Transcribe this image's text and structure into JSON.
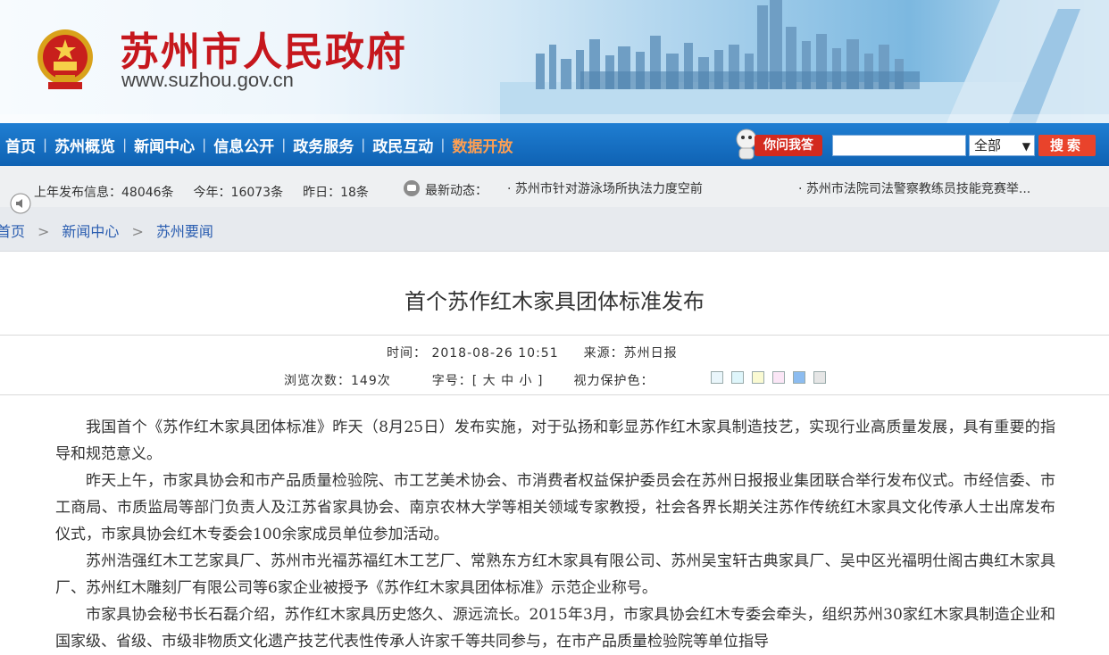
{
  "header": {
    "site_title": "苏州市人民政府",
    "site_url": "www.suzhou.gov.cn"
  },
  "nav": {
    "items": [
      "首页",
      "苏州概览",
      "新闻中心",
      "信息公开",
      "政务服务",
      "政民互动",
      "数据开放"
    ],
    "separator": "|",
    "ask_label": "你问我答",
    "search_placeholder": "",
    "search_scope": "全部",
    "search_button": "搜索"
  },
  "infobar": {
    "last_year": "上年发布信息：48046条",
    "this_year": "今年：16073条",
    "yesterday": "昨日：18条",
    "latest_label": "最新动态：",
    "news": [
      "· 苏州市针对游泳场所执法力度空前",
      "· 苏州市法院司法警察教练员技能竞赛举..."
    ]
  },
  "breadcrumb": [
    "首页",
    "新闻中心",
    "苏州要闻"
  ],
  "article": {
    "title": "首个苏作红木家具团体标准发布",
    "time": "时间： 2018-08-26 10:51",
    "source": "来源：苏州日报",
    "views": "浏览次数：149次",
    "font_size": "字号：[ 大  中  小 ]",
    "eye_care": "视力保护色：",
    "eye_colors": [
      "#eaf6fb",
      "#dff6fb",
      "#fafad2",
      "#fbe6f6",
      "#8cbcf0",
      "#e6e6e6"
    ],
    "paragraphs": [
      "我国首个《苏作红木家具团体标准》昨天（8月25日）发布实施，对于弘扬和彰显苏作红木家具制造技艺，实现行业高质量发展，具有重要的指导和规范意义。",
      "昨天上午，市家具协会和市产品质量检验院、市工艺美术协会、市消费者权益保护委员会在苏州日报报业集团联合举行发布仪式。市经信委、市工商局、市质监局等部门负责人及江苏省家具协会、南京农林大学等相关领域专家教授，社会各界长期关注苏作传统红木家具文化传承人士出席发布仪式，市家具协会红木专委会100余家成员单位参加活动。",
      "苏州浩强红木工艺家具厂、苏州市光福苏福红木工艺厂、常熟东方红木家具有限公司、苏州吴宝轩古典家具厂、吴中区光福明仕阁古典红木家具厂、苏州红木雕刻厂有限公司等6家企业被授予《苏作红木家具团体标准》示范企业称号。",
      "市家具协会秘书长石磊介绍，苏作红木家具历史悠久、源远流长。2015年3月，市家具协会红木专委会牵头，组织苏州30家红木家具制造企业和国家级、省级、市级非物质文化遗产技艺代表性传承人许家千等共同参与，在市产品质量检验院等单位指导"
    ]
  }
}
